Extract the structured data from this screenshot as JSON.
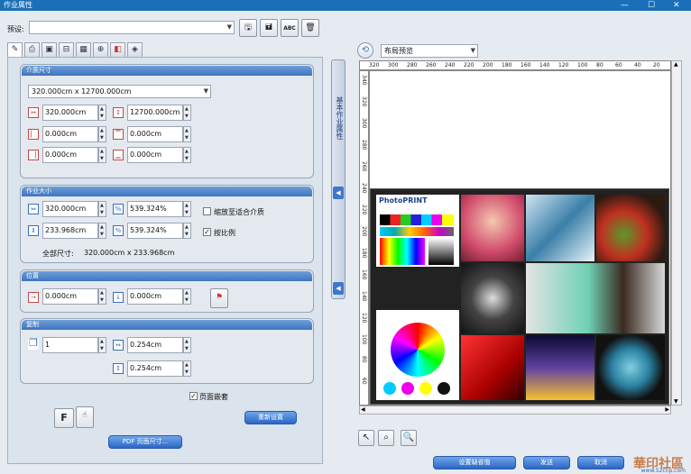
{
  "window": {
    "title": "作业属性"
  },
  "preset": {
    "label": "预设:",
    "value": ""
  },
  "media_size": {
    "header": "介质尺寸",
    "selected": "320.000cm x 12700.000cm",
    "width": "320.000cm",
    "height": "12700.000cm",
    "margin_left": "0.000cm",
    "margin_right": "0.000cm",
    "margin_top": "0.000cm",
    "margin_bottom": "0.000cm"
  },
  "job_size": {
    "header": "作业大小",
    "width": "320.000cm",
    "width_pct": "539.324%",
    "height": "233.968cm",
    "height_pct": "539.324%",
    "fit_media_label": "缩放至适合介质",
    "fit_media_checked": false,
    "keep_ratio_label": "按比例",
    "keep_ratio_checked": true,
    "total_label": "全部尺寸:",
    "total_value": "320.000cm x 233.968cm"
  },
  "position": {
    "header": "位置",
    "x": "0.000cm",
    "y": "0.000cm"
  },
  "copies": {
    "header": "复制",
    "count": "1",
    "h_gap": "0.254cm",
    "v_gap": "0.254cm"
  },
  "page_nesting": {
    "label": "页面嵌套",
    "checked": true
  },
  "buttons": {
    "f_label": "F",
    "reset": "重新设置",
    "pdf_size": "PDF 页面尺寸...",
    "set_default": "设置缺省值",
    "send": "发送",
    "cancel": "取消"
  },
  "side_tab": {
    "label": "基本作业属性"
  },
  "preview": {
    "mode": "布局预览",
    "ruler_top": [
      "320",
      "300",
      "280",
      "260",
      "240",
      "220",
      "200",
      "180",
      "160",
      "140",
      "120",
      "100",
      "80",
      "60",
      "40",
      "20"
    ],
    "ruler_left": [
      "340",
      "320",
      "300",
      "280",
      "260",
      "240",
      "220",
      "200",
      "180",
      "160",
      "140",
      "120",
      "100",
      "80",
      "60"
    ]
  },
  "artwork": {
    "brand": "PhotoPRINT"
  },
  "watermark": {
    "text": "華印社區",
    "url": "www.52cnp.com"
  },
  "colors": {
    "accent": "#3d77cf",
    "title": "#1a70b8"
  }
}
